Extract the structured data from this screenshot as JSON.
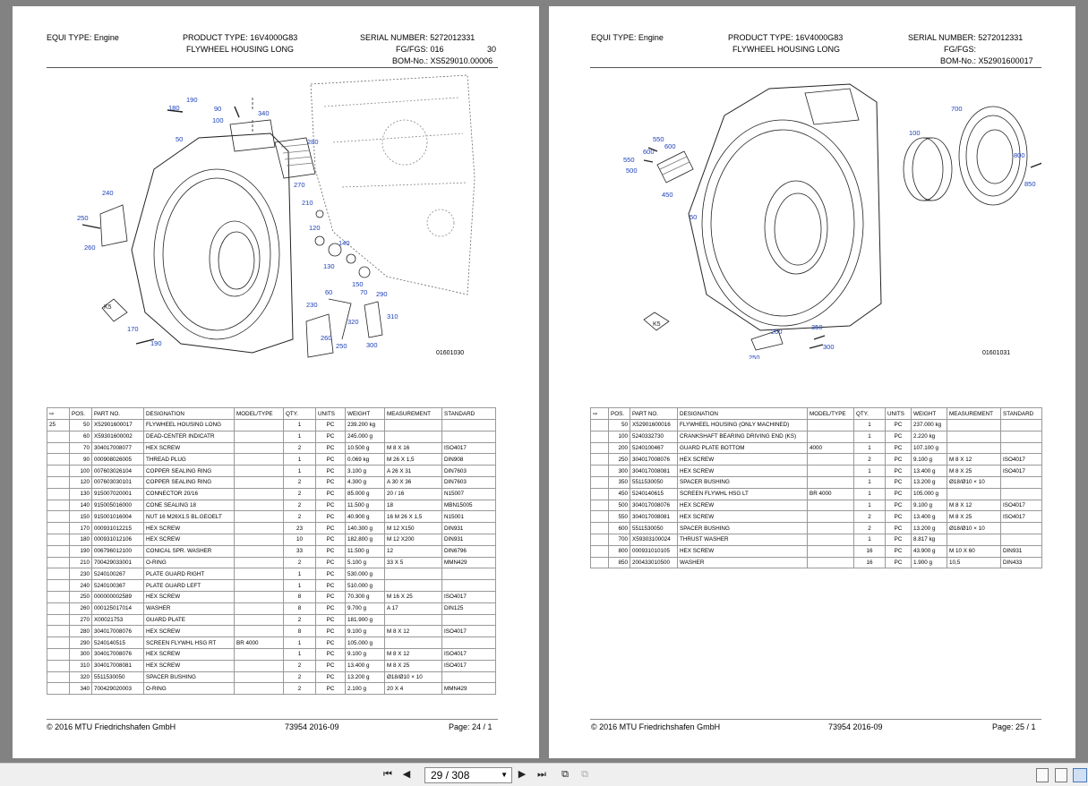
{
  "pages": [
    {
      "equi_type_label": "EQUI TYPE:",
      "equi_type": "Engine",
      "product_type_label": "PRODUCT TYPE:",
      "product_type": "16V4000G83",
      "serial_label": "SERIAL NUMBER:",
      "serial": "5272012331",
      "title": "FLYWHEEL HOUSING LONG",
      "fgfgs_label": "FG/FGS:",
      "fgfgs_value": "016",
      "fgfgs_extra": "30",
      "bom_label": "BOM-No.:",
      "bom": "XS529010.00006",
      "drawing_number": "01601030",
      "callouts": [
        "190",
        "180",
        "90",
        "100",
        "340",
        "50",
        "280",
        "270",
        "240",
        "250",
        "260",
        "210",
        "120",
        "140",
        "130",
        "150",
        "60",
        "70",
        "290",
        "230",
        "320",
        "310",
        "260",
        "250",
        "300",
        "170",
        "190",
        "K5"
      ],
      "columns": [
        "POS.",
        "PART NO.",
        "DESIGNATION",
        "MODEL/TYPE",
        "QTY.",
        "UNITS",
        "WEIGHT",
        "MEASUREMENT",
        "STANDARD"
      ],
      "rows": [
        {
          "lvl": "25",
          "pos": "50",
          "part": "X52901600017",
          "des": "FLYWHEEL HOUSING LONG",
          "model": "",
          "qty": "1",
          "unit": "PC",
          "weight": "239.200 kg",
          "meas": "",
          "std": ""
        },
        {
          "lvl": "",
          "pos": "60",
          "part": "X59301600002",
          "des": "DEAD-CENTER INDICATR",
          "model": "",
          "qty": "1",
          "unit": "PC",
          "weight": "245.000 g",
          "meas": "",
          "std": ""
        },
        {
          "lvl": "",
          "pos": "70",
          "part": "304017008077",
          "des": "HEX SCREW",
          "model": "",
          "qty": "2",
          "unit": "PC",
          "weight": "10.500 g",
          "meas": "M 8 X 16",
          "std": "ISO4017"
        },
        {
          "lvl": "",
          "pos": "90",
          "part": "000908026005",
          "des": "THREAD PLUG",
          "model": "",
          "qty": "1",
          "unit": "PC",
          "weight": "0.069 kg",
          "meas": "M 26 X 1,5",
          "std": "DIN908"
        },
        {
          "lvl": "",
          "pos": "100",
          "part": "007603026104",
          "des": "COPPER SEALING RING",
          "model": "",
          "qty": "1",
          "unit": "PC",
          "weight": "3.100 g",
          "meas": "A 26 X 31",
          "std": "DIN7603"
        },
        {
          "lvl": "",
          "pos": "120",
          "part": "007603030101",
          "des": "COPPER SEALING RING",
          "model": "",
          "qty": "2",
          "unit": "PC",
          "weight": "4.300 g",
          "meas": "A 30 X 36",
          "std": "DIN7603"
        },
        {
          "lvl": "",
          "pos": "130",
          "part": "915007020001",
          "des": "CONNECTOR 20/16",
          "model": "",
          "qty": "2",
          "unit": "PC",
          "weight": "85.000 g",
          "meas": "20 / 16",
          "std": "N15007"
        },
        {
          "lvl": "",
          "pos": "140",
          "part": "915005016000",
          "des": "CONE SEALING 18",
          "model": "",
          "qty": "2",
          "unit": "PC",
          "weight": "11.500 g",
          "meas": "18",
          "std": "MBN15005"
        },
        {
          "lvl": "",
          "pos": "150",
          "part": "915001016004",
          "des": "NUT 16 M26X1.5 BL.GEOELT",
          "model": "",
          "qty": "2",
          "unit": "PC",
          "weight": "40.900 g",
          "meas": "16 M 26 X 1,5",
          "std": "N15001"
        },
        {
          "lvl": "",
          "pos": "170",
          "part": "000931012215",
          "des": "HEX SCREW",
          "model": "",
          "qty": "23",
          "unit": "PC",
          "weight": "140.300 g",
          "meas": "M 12 X150",
          "std": "DIN931"
        },
        {
          "lvl": "",
          "pos": "180",
          "part": "000931012106",
          "des": "HEX SCREW",
          "model": "",
          "qty": "10",
          "unit": "PC",
          "weight": "182.800 g",
          "meas": "M 12 X200",
          "std": "DIN931"
        },
        {
          "lvl": "",
          "pos": "190",
          "part": "006796012100",
          "des": "CONICAL SPR. WASHER",
          "model": "",
          "qty": "33",
          "unit": "PC",
          "weight": "11.500 g",
          "meas": "12",
          "std": "DIN6796"
        },
        {
          "lvl": "",
          "pos": "210",
          "part": "700429033001",
          "des": "O-RING",
          "model": "",
          "qty": "2",
          "unit": "PC",
          "weight": "5.100 g",
          "meas": "33 X 5",
          "std": "MMN429"
        },
        {
          "lvl": "",
          "pos": "230",
          "part": "5240100267",
          "des": "PLATE GUARD RIGHT",
          "model": "",
          "qty": "1",
          "unit": "PC",
          "weight": "530.000 g",
          "meas": "",
          "std": ""
        },
        {
          "lvl": "",
          "pos": "240",
          "part": "5240100367",
          "des": "PLATE GUARD LEFT",
          "model": "",
          "qty": "1",
          "unit": "PC",
          "weight": "510.000 g",
          "meas": "",
          "std": ""
        },
        {
          "lvl": "",
          "pos": "250",
          "part": "000000002589",
          "des": "HEX SCREW",
          "model": "",
          "qty": "8",
          "unit": "PC",
          "weight": "70.300 g",
          "meas": "M 16 X 25",
          "std": "ISO4017"
        },
        {
          "lvl": "",
          "pos": "260",
          "part": "000125017014",
          "des": "WASHER",
          "model": "",
          "qty": "8",
          "unit": "PC",
          "weight": "9.700 g",
          "meas": "A 17",
          "std": "DIN125"
        },
        {
          "lvl": "",
          "pos": "270",
          "part": "X00021753",
          "des": "GUARD PLATE",
          "model": "",
          "qty": "2",
          "unit": "PC",
          "weight": "181.900 g",
          "meas": "",
          "std": ""
        },
        {
          "lvl": "",
          "pos": "280",
          "part": "304017008076",
          "des": "HEX SCREW",
          "model": "",
          "qty": "8",
          "unit": "PC",
          "weight": "9.100 g",
          "meas": "M 8 X 12",
          "std": "ISO4017"
        },
        {
          "lvl": "",
          "pos": "290",
          "part": "5240140515",
          "des": "SCREEN FLYWHL HSG RT",
          "model": "BR 4000",
          "qty": "1",
          "unit": "PC",
          "weight": "105.000 g",
          "meas": "",
          "std": ""
        },
        {
          "lvl": "",
          "pos": "300",
          "part": "304017008076",
          "des": "HEX SCREW",
          "model": "",
          "qty": "1",
          "unit": "PC",
          "weight": "9.100 g",
          "meas": "M 8 X 12",
          "std": "ISO4017"
        },
        {
          "lvl": "",
          "pos": "310",
          "part": "304017008081",
          "des": "HEX SCREW",
          "model": "",
          "qty": "2",
          "unit": "PC",
          "weight": "13.400 g",
          "meas": "M 8 X 25",
          "std": "ISO4017"
        },
        {
          "lvl": "",
          "pos": "320",
          "part": "5511530050",
          "des": "SPACER BUSHING",
          "model": "",
          "qty": "2",
          "unit": "PC",
          "weight": "13.200 g",
          "meas": "Ø18/Ø10 × 10",
          "std": ""
        },
        {
          "lvl": "",
          "pos": "340",
          "part": "700429020003",
          "des": "O-RING",
          "model": "",
          "qty": "2",
          "unit": "PC",
          "weight": "2.100 g",
          "meas": "20 X 4",
          "std": "MMN429"
        }
      ],
      "copyright": "© 2016 MTU Friedrichshafen GmbH",
      "doc_ref": "73954  2016-09",
      "page_label": "Page:",
      "page_num": "24  /  1"
    },
    {
      "equi_type_label": "EQUI TYPE:",
      "equi_type": "Engine",
      "product_type_label": "PRODUCT TYPE:",
      "product_type": "16V4000G83",
      "serial_label": "SERIAL NUMBER:",
      "serial": "5272012331",
      "title": "FLYWHEEL HOUSING LONG",
      "fgfgs_label": "FG/FGS:",
      "fgfgs_value": "",
      "fgfgs_extra": "",
      "bom_label": "BOM-No.:",
      "bom": "X52901600017",
      "drawing_number": "01601031",
      "callouts": [
        "700",
        "550",
        "600",
        "100",
        "800",
        "550",
        "600",
        "500",
        "850",
        "450",
        "50",
        "K5",
        "200",
        "350",
        "300",
        "250"
      ],
      "columns": [
        "POS.",
        "PART NO.",
        "DESIGNATION",
        "MODEL/TYPE",
        "QTY.",
        "UNITS",
        "WEIGHT",
        "MEASUREMENT",
        "STANDARD"
      ],
      "rows": [
        {
          "lvl": "",
          "pos": "50",
          "part": "X52901600016",
          "des": "FLYWHEEL HOUSING (ONLY MACHINED)",
          "model": "",
          "qty": "1",
          "unit": "PC",
          "weight": "237.000 kg",
          "meas": "",
          "std": ""
        },
        {
          "lvl": "",
          "pos": "100",
          "part": "5240332730",
          "des": "CRANKSHAFT BEARING DRIVING END (KS)",
          "model": "",
          "qty": "1",
          "unit": "PC",
          "weight": "2.220 kg",
          "meas": "",
          "std": ""
        },
        {
          "lvl": "",
          "pos": "200",
          "part": "5240100467",
          "des": "GUARD PLATE BOTTOM",
          "model": "4000",
          "qty": "1",
          "unit": "PC",
          "weight": "107.100 g",
          "meas": "",
          "std": ""
        },
        {
          "lvl": "",
          "pos": "250",
          "part": "304017008076",
          "des": "HEX SCREW",
          "model": "",
          "qty": "2",
          "unit": "PC",
          "weight": "9.100 g",
          "meas": "M 8 X 12",
          "std": "ISO4017"
        },
        {
          "lvl": "",
          "pos": "300",
          "part": "304017008081",
          "des": "HEX SCREW",
          "model": "",
          "qty": "1",
          "unit": "PC",
          "weight": "13.400 g",
          "meas": "M 8 X 25",
          "std": "ISO4017"
        },
        {
          "lvl": "",
          "pos": "350",
          "part": "5511530050",
          "des": "SPACER BUSHING",
          "model": "",
          "qty": "1",
          "unit": "PC",
          "weight": "13.200 g",
          "meas": "Ø18/Ø10 × 10",
          "std": ""
        },
        {
          "lvl": "",
          "pos": "450",
          "part": "5240140615",
          "des": "SCREEN FLYWHL HSG LT",
          "model": "BR 4000",
          "qty": "1",
          "unit": "PC",
          "weight": "105.000 g",
          "meas": "",
          "std": ""
        },
        {
          "lvl": "",
          "pos": "500",
          "part": "304017008076",
          "des": "HEX SCREW",
          "model": "",
          "qty": "1",
          "unit": "PC",
          "weight": "9.100 g",
          "meas": "M 8 X 12",
          "std": "ISO4017"
        },
        {
          "lvl": "",
          "pos": "550",
          "part": "304017008081",
          "des": "HEX SCREW",
          "model": "",
          "qty": "2",
          "unit": "PC",
          "weight": "13.400 g",
          "meas": "M 8 X 25",
          "std": "ISO4017"
        },
        {
          "lvl": "",
          "pos": "600",
          "part": "5511530050",
          "des": "SPACER BUSHING",
          "model": "",
          "qty": "2",
          "unit": "PC",
          "weight": "13.200 g",
          "meas": "Ø18/Ø10 × 10",
          "std": ""
        },
        {
          "lvl": "",
          "pos": "700",
          "part": "X59303100024",
          "des": "THRUST WASHER",
          "model": "",
          "qty": "1",
          "unit": "PC",
          "weight": "8.817 kg",
          "meas": "",
          "std": ""
        },
        {
          "lvl": "",
          "pos": "800",
          "part": "000931010105",
          "des": "HEX SCREW",
          "model": "",
          "qty": "16",
          "unit": "PC",
          "weight": "43.900 g",
          "meas": "M 10 X 60",
          "std": "DIN931"
        },
        {
          "lvl": "",
          "pos": "850",
          "part": "200433010500",
          "des": "WASHER",
          "model": "",
          "qty": "16",
          "unit": "PC",
          "weight": "1.900 g",
          "meas": "10,5",
          "std": "DIN433"
        }
      ],
      "copyright": "© 2016 MTU Friedrichshafen GmbH",
      "doc_ref": "73954  2016-09",
      "page_label": "Page:",
      "page_num": "25  /  1"
    }
  ],
  "toolbar": {
    "first_icon": "first-page-icon",
    "prev_icon": "previous-page-icon",
    "page_value": "29 / 308",
    "next_icon": "next-page-icon",
    "last_icon": "last-page-icon",
    "view_icons": [
      "single-page-view-icon",
      "continuous-view-icon",
      "two-page-view-icon"
    ]
  }
}
